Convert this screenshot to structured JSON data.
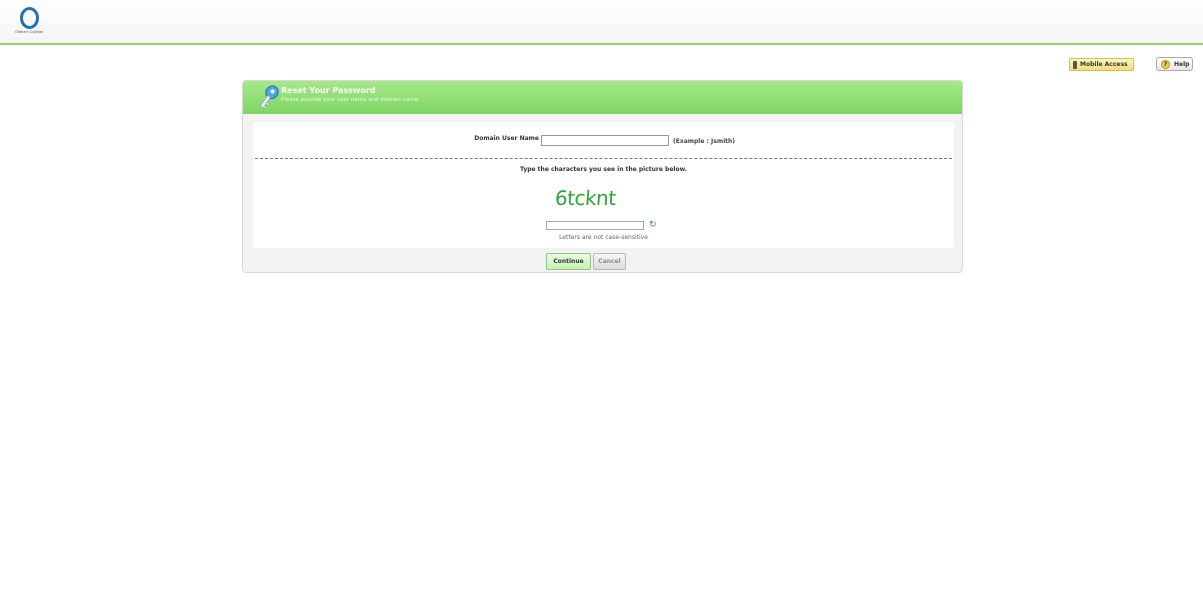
{
  "header": {
    "logo_text": "Oldham College",
    "brand_color": "#1b72b8",
    "accent_color": "#8fd46a"
  },
  "toolbar": {
    "mobile_access_label": "Mobile Access",
    "mobile_icon": "phone-icon",
    "help_label": "Help",
    "help_icon": "help-icon",
    "help_icon_glyph": "?"
  },
  "panel": {
    "title": "Reset Your Password",
    "subtitle": "Please provide your user name and domain name.",
    "header_icon": "key-icon"
  },
  "form": {
    "domain_label": "Domain User Name",
    "domain_value": "",
    "domain_example": "(Example : Jsmith)",
    "captcha_prompt": "Type the characters you see in the picture below.",
    "captcha_image_text": "6tcknt",
    "captcha_value": "",
    "refresh_icon": "refresh-icon",
    "case_note": "Letters are not case-sensitive",
    "continue_label": "Continue",
    "cancel_label": "Cancel"
  }
}
